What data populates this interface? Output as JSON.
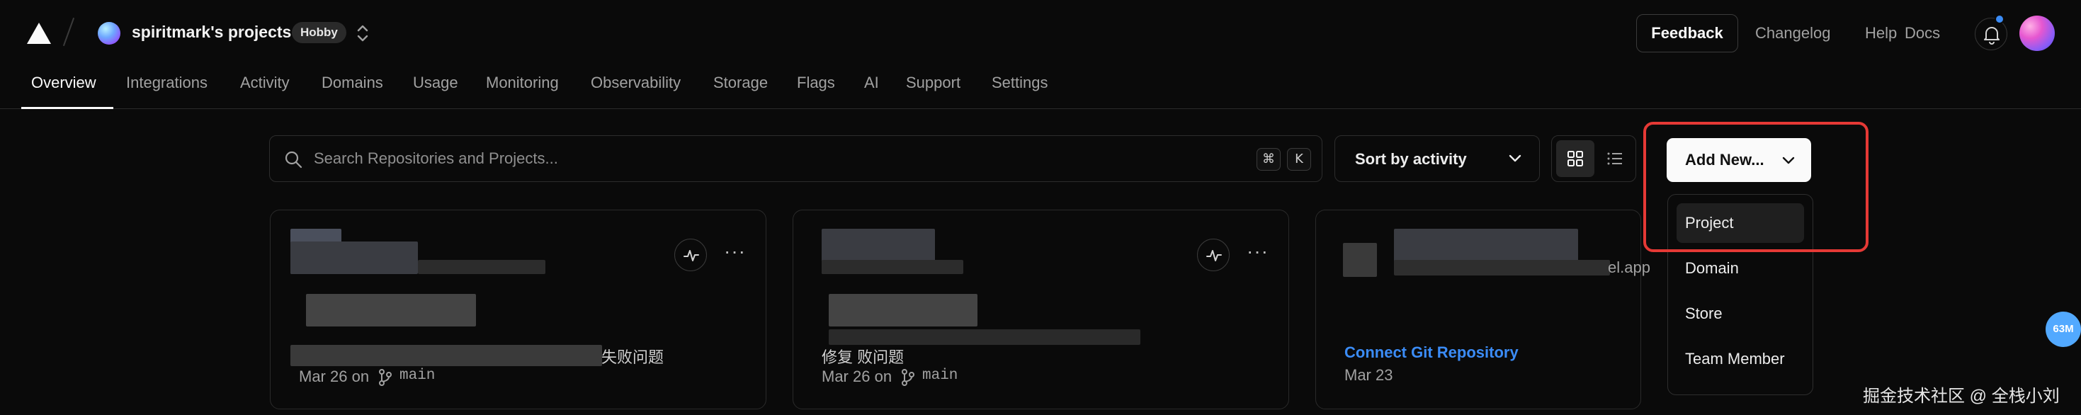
{
  "header": {
    "logo": "vercel-triangle-icon",
    "team_name": "spiritmark's projects",
    "plan_badge": "Hobby",
    "feedback_label": "Feedback",
    "links": [
      "Changelog",
      "Help",
      "Docs"
    ],
    "notification_dot_color": "#3b8cf6"
  },
  "nav": {
    "active": "Overview",
    "tabs": [
      "Overview",
      "Integrations",
      "Activity",
      "Domains",
      "Usage",
      "Monitoring",
      "Observability",
      "Storage",
      "Flags",
      "AI",
      "Support",
      "Settings"
    ]
  },
  "toolbar": {
    "search_placeholder": "Search Repositories and Projects...",
    "shortcut_keys": [
      "⌘",
      "K"
    ],
    "sort_label": "Sort by activity",
    "view_selected": "grid",
    "add_new_label": "Add New..."
  },
  "add_new_menu": {
    "highlighted": "Project",
    "items": [
      "Project",
      "Domain",
      "Store",
      "Team Member"
    ]
  },
  "cards": [
    {
      "commit_suffix": "失败问题",
      "date": "Mar 26 on",
      "branch": "main"
    },
    {
      "commit_text": "修复                      败问题",
      "date": "Mar 26 on",
      "branch": "main"
    },
    {
      "domain_suffix": "el.app",
      "connect_label": "Connect Git Repository",
      "date": "Mar 23"
    }
  ],
  "overlay": {
    "memory_badge": "63M",
    "watermark": "掘金技术社区 @ 全栈小刘"
  },
  "colors": {
    "background": "#0a0a0a",
    "accent_link": "#3b8cf6",
    "highlight_border": "#e53935"
  }
}
